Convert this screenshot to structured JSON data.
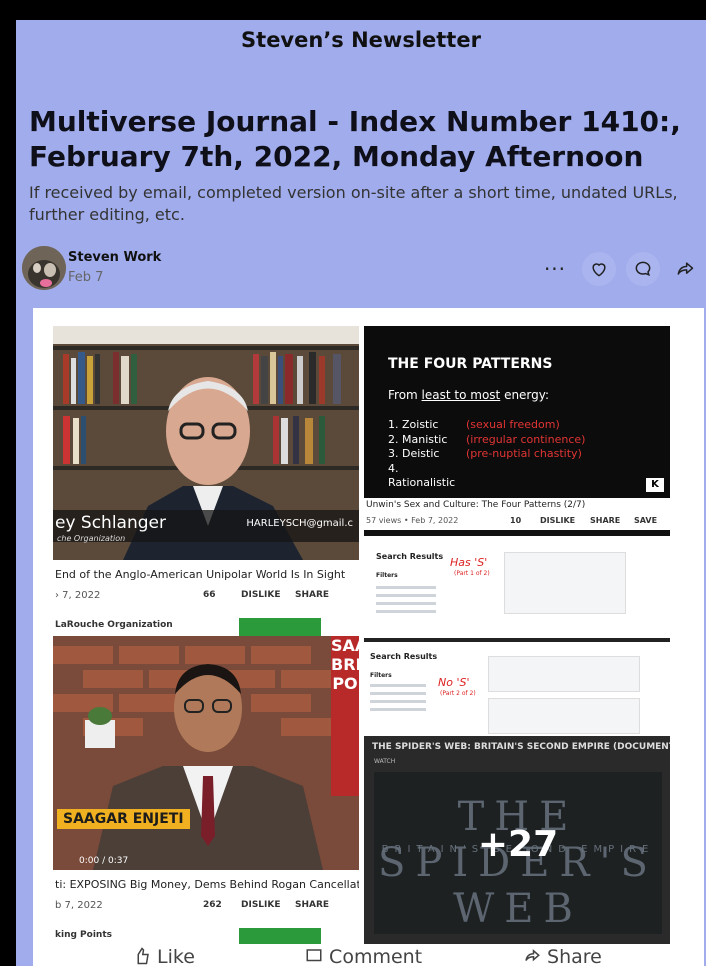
{
  "publication": "Steven’s Newsletter",
  "post": {
    "title": "Multiverse Journal - Index Number 1410:, February 7th, 2022, Monday Afternoon",
    "subtitle": "If received by email, completed version on-site after a short time, undated URLs, further editing, etc.",
    "author": "Steven Work",
    "date": "Feb 7"
  },
  "actions": {
    "more_label": "···",
    "icons": [
      "heart-icon",
      "comment-icon",
      "share-icon"
    ]
  },
  "collage": {
    "video1": {
      "name_overlay": "ey Schlanger",
      "channel_overlay": "che Organization",
      "email_overlay": "HARLEYSCH@gmail.c",
      "title": "End of the Anglo-American Unipolar World Is In Sight",
      "date": "› 7, 2022",
      "likes": "66",
      "dislike_label": "DISLIKE",
      "share_label": "SHARE",
      "channel": "LaRouche Organization"
    },
    "video2": {
      "heading": "THE FOUR PATTERNS",
      "sub_prefix": "From ",
      "sub_underlined": "least to most",
      "sub_suffix": " energy:",
      "items": [
        {
          "label": "1. Zoistic",
          "note": "(sexual freedom)"
        },
        {
          "label": "2. Manistic",
          "note": "(irregular continence)"
        },
        {
          "label": "3. Deistic",
          "note": "(pre-nuptial chastity)"
        },
        {
          "label": "4. Rationalistic",
          "note": ""
        }
      ],
      "title": "Unwin's Sex and Culture: The Four Patterns (2/7)",
      "meta": "57 views • Feb 7, 2022",
      "likes": "10",
      "dislike_label": "DISLIKE",
      "share_label": "SHARE",
      "save_label": "SAVE"
    },
    "fb1": {
      "search_results": "Search Results",
      "filters": "Filters",
      "annotation": "Has 'S'",
      "annotation_sub": "(Part 1 of 2)"
    },
    "fb2": {
      "search_results": "Search Results",
      "filters": "Filters",
      "annotation": "No 'S'",
      "annotation_sub": "(Part 2 of 2)"
    },
    "video3": {
      "name_overlay": "SAAGAR ENJETI",
      "time": "0:00 / 0:37",
      "side_text": [
        "SAA",
        "BRE",
        "PO"
      ],
      "title": "ti: EXPOSING Big Money, Dems Behind Rogan Cancellation",
      "date": "b 7, 2022",
      "likes": "262",
      "dislike_label": "DISLIKE",
      "share_label": "SHARE",
      "channel": "king Points"
    },
    "video4": {
      "title": "THE SPIDER'S WEB: BRITAIN'S SECOND EMPIRE (DOCUMENTARY)",
      "watch": "WATCH",
      "film_title": "THE SPIDER'S WEB",
      "film_sub": "BRITAIN'S SECOND EMPIRE",
      "more_count": "+27"
    }
  },
  "bottom_bar": {
    "like": "Like",
    "comment": "Comment",
    "share": "Share"
  },
  "colors": {
    "background": "#a0acec",
    "red_annotation": "#e23434"
  }
}
